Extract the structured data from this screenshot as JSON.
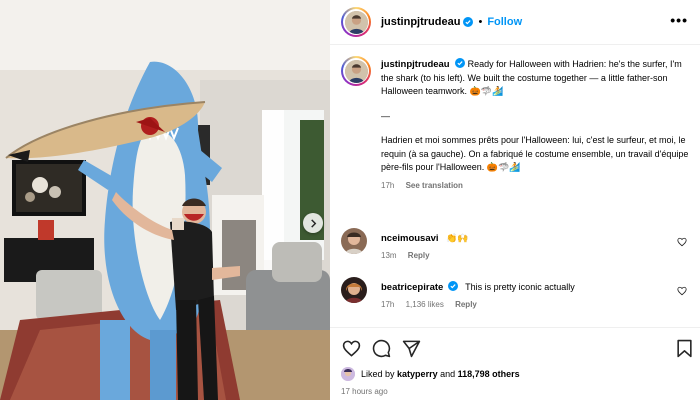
{
  "post": {
    "username": "justinpjtrudeau",
    "follow_label": "Follow",
    "separator": "•",
    "more_label": "•••"
  },
  "caption": {
    "username": "justinpjtrudeau",
    "text_en": "Ready for Halloween with Hadrien: he's the surfer, I'm the shark (to his left). We built the costume together — a little father-son Halloween teamwork. 🎃🦈🏄",
    "divider": "—",
    "text_fr": "Hadrien et moi sommes prêts pour l'Halloween: lui, c'est le surfeur, et moi, le requin (à sa gauche). On a fabriqué le costume ensemble, un travail d'équipe père-fils pour l'Halloween. 🎃🦈🏄",
    "time": "17h",
    "see_translation": "See translation"
  },
  "comments": [
    {
      "username": "nceimousavi",
      "text": "👏🙌",
      "time": "13m",
      "likes": "",
      "reply": "Reply"
    },
    {
      "username": "beatricepirate",
      "text": "This is pretty iconic actually",
      "time": "17h",
      "likes": "1,136 likes",
      "reply": "Reply"
    }
  ],
  "footer": {
    "liked_by_prefix": "Liked by",
    "liked_by_user": "katyperry",
    "liked_by_and": "and",
    "liked_by_count": "118,798 others",
    "time_ago": "17 hours ago"
  },
  "icons": {
    "verified": "verified-badge-icon",
    "heart": "heart-icon",
    "comment": "comment-icon",
    "share": "share-icon",
    "save": "bookmark-icon",
    "next": "chevron-right-icon"
  },
  "colors": {
    "link_blue": "#0095f6",
    "secondary_text": "#737373",
    "shark_blue": "#6aa8dc"
  }
}
